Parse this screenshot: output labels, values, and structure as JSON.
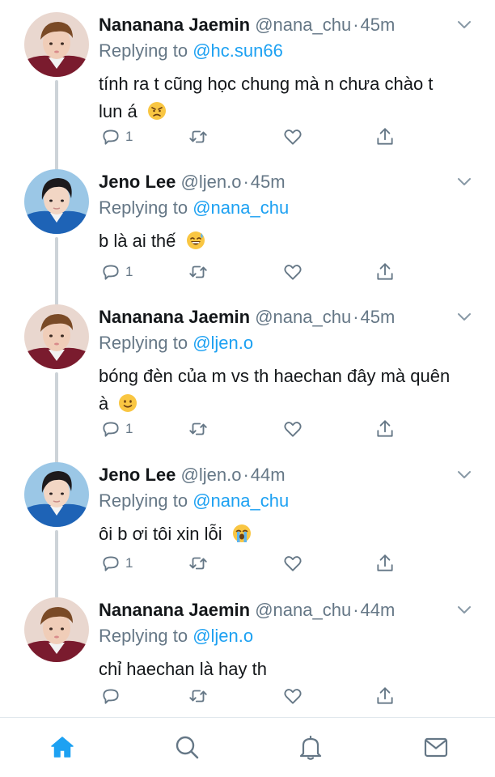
{
  "thread": {
    "tweets": [
      {
        "name": "Nananana Jaemin",
        "handle": "@nana_chu",
        "time": "45m",
        "replying_label": "Replying to",
        "replying_to": "@hc.sun66",
        "text": "tính ra t cũng học chung mà n chưa chào t lun á",
        "emoji": "angry-face-emoji",
        "reply_count": "1",
        "avatar": "avatar-jaemin"
      },
      {
        "name": "Jeno Lee",
        "handle": "@ljen.o",
        "time": "45m",
        "replying_label": "Replying to",
        "replying_to": "@nana_chu",
        "text": "b là ai thế",
        "emoji": "sweat-smile-emoji",
        "reply_count": "1",
        "avatar": "avatar-jeno"
      },
      {
        "name": "Nananana Jaemin",
        "handle": "@nana_chu",
        "time": "45m",
        "replying_label": "Replying to",
        "replying_to": "@ljen.o",
        "text": "bóng đèn của m vs th haechan đây mà quên à",
        "emoji": "slight-smile-emoji",
        "reply_count": "1",
        "avatar": "avatar-jaemin"
      },
      {
        "name": "Jeno Lee",
        "handle": "@ljen.o",
        "time": "44m",
        "replying_label": "Replying to",
        "replying_to": "@nana_chu",
        "text": "ôi b ơi tôi xin lỗi",
        "emoji": "loudly-crying-emoji",
        "reply_count": "1",
        "avatar": "avatar-jeno"
      },
      {
        "name": "Nananana Jaemin",
        "handle": "@nana_chu",
        "time": "44m",
        "replying_label": "Replying to",
        "replying_to": "@ljen.o",
        "text": "chỉ haechan là hay th",
        "emoji": "",
        "reply_count": "",
        "avatar": "avatar-jaemin"
      }
    ]
  },
  "tabbar": {
    "items": [
      {
        "icon": "home-icon",
        "active": true
      },
      {
        "icon": "search-icon",
        "active": false
      },
      {
        "icon": "bell-icon",
        "active": false
      },
      {
        "icon": "mail-icon",
        "active": false
      }
    ]
  },
  "colors": {
    "accent": "#1da1f2",
    "secondary_text": "#657786",
    "primary_text": "#14171a",
    "thread_line": "#cdd3d8",
    "icon_gray": "#657786"
  }
}
